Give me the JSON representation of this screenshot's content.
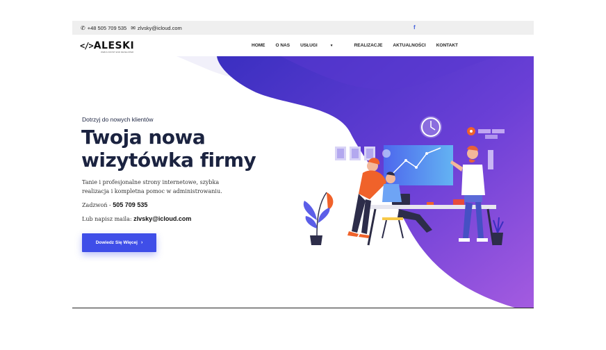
{
  "topbar": {
    "phone": "+48 505 709 535",
    "email": "zlvsky@icloud.com",
    "phone_icon": "phone-icon",
    "email_icon": "envelope-icon",
    "social_icon": "facebook-icon",
    "social_label": "f"
  },
  "logo": {
    "mark": "</>",
    "word": "ALESKI",
    "tagline": "WEB & FRONT END DEVELOPER"
  },
  "menu": {
    "items": [
      "HOME",
      "O NAS",
      "USŁUGI",
      "REALIZACJE",
      "AKTUALNOŚCI",
      "KONTAKT"
    ],
    "dropdown_icon": "chevron-down-icon"
  },
  "hero": {
    "eyebrow": "Dotrzyj do nowych klientów",
    "headline_line1": "Twoja nowa",
    "headline_line2": "wizytówka firmy",
    "description": "Tanie i profesjonalne strony internetowe, szybka realizacja i kompletna pomoc w administrowaniu.",
    "call_label": "Zadzwoń - ",
    "call_number": "505 709 535",
    "mail_label": "Lub napisz maila: ",
    "mail_address": "zlvsky@icloud.com",
    "button_label": "Dowiedz Się Więcej",
    "button_icon": "chevron-right-icon"
  },
  "colors": {
    "accent": "#3f4ee8",
    "purple_dark": "#4a32c9",
    "purple_light": "#a05ae0",
    "orange": "#f0622a",
    "heading": "#1b2340"
  }
}
